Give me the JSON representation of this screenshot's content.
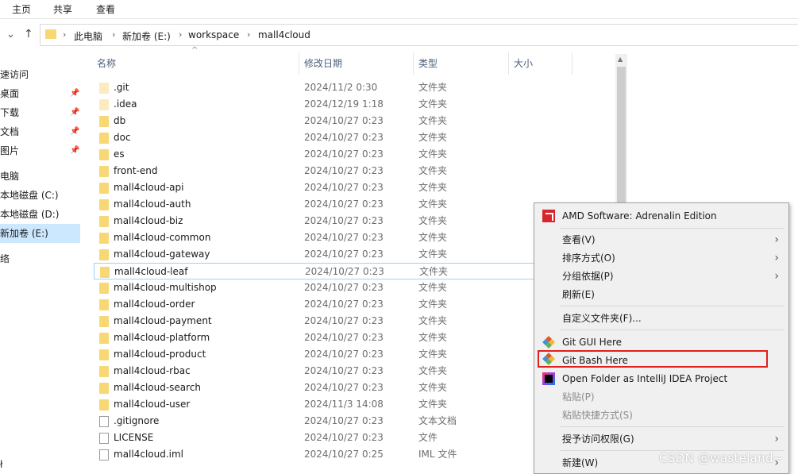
{
  "ribbon": {
    "tabs": [
      "主页",
      "共享",
      "查看"
    ]
  },
  "address": {
    "crumbs": [
      "此电脑",
      "新加卷 (E:)",
      "workspace",
      "mall4cloud"
    ],
    "separator": "›"
  },
  "nav": {
    "items": [
      {
        "label": "速访问",
        "pinned": false
      },
      {
        "label": "桌面",
        "pinned": true
      },
      {
        "label": "下载",
        "pinned": true
      },
      {
        "label": "文档",
        "pinned": true
      },
      {
        "label": "图片",
        "pinned": true
      },
      {
        "label": "电脑",
        "pinned": false
      },
      {
        "label": "本地磁盘 (C:)",
        "pinned": false
      },
      {
        "label": "本地磁盘 (D:)",
        "pinned": false
      },
      {
        "label": "新加卷 (E:)",
        "pinned": false,
        "selected": true
      },
      {
        "label": "络",
        "pinned": false
      }
    ],
    "bottom_item": "ł"
  },
  "columns": {
    "name": "名称",
    "date": "修改日期",
    "type": "类型",
    "size": "大小"
  },
  "files": [
    {
      "name": ".git",
      "date": "2024/11/2 0:30",
      "type": "文件夹",
      "kind": "folder-hidden"
    },
    {
      "name": ".idea",
      "date": "2024/12/19 1:18",
      "type": "文件夹",
      "kind": "folder-hidden"
    },
    {
      "name": "db",
      "date": "2024/10/27 0:23",
      "type": "文件夹",
      "kind": "folder"
    },
    {
      "name": "doc",
      "date": "2024/10/27 0:23",
      "type": "文件夹",
      "kind": "folder"
    },
    {
      "name": "es",
      "date": "2024/10/27 0:23",
      "type": "文件夹",
      "kind": "folder"
    },
    {
      "name": "front-end",
      "date": "2024/10/27 0:23",
      "type": "文件夹",
      "kind": "folder"
    },
    {
      "name": "mall4cloud-api",
      "date": "2024/10/27 0:23",
      "type": "文件夹",
      "kind": "folder"
    },
    {
      "name": "mall4cloud-auth",
      "date": "2024/10/27 0:23",
      "type": "文件夹",
      "kind": "folder"
    },
    {
      "name": "mall4cloud-biz",
      "date": "2024/10/27 0:23",
      "type": "文件夹",
      "kind": "folder"
    },
    {
      "name": "mall4cloud-common",
      "date": "2024/10/27 0:23",
      "type": "文件夹",
      "kind": "folder"
    },
    {
      "name": "mall4cloud-gateway",
      "date": "2024/10/27 0:23",
      "type": "文件夹",
      "kind": "folder"
    },
    {
      "name": "mall4cloud-leaf",
      "date": "2024/10/27 0:23",
      "type": "文件夹",
      "kind": "folder",
      "hover": true
    },
    {
      "name": "mall4cloud-multishop",
      "date": "2024/10/27 0:23",
      "type": "文件夹",
      "kind": "folder"
    },
    {
      "name": "mall4cloud-order",
      "date": "2024/10/27 0:23",
      "type": "文件夹",
      "kind": "folder"
    },
    {
      "name": "mall4cloud-payment",
      "date": "2024/10/27 0:23",
      "type": "文件夹",
      "kind": "folder"
    },
    {
      "name": "mall4cloud-platform",
      "date": "2024/10/27 0:23",
      "type": "文件夹",
      "kind": "folder"
    },
    {
      "name": "mall4cloud-product",
      "date": "2024/10/27 0:23",
      "type": "文件夹",
      "kind": "folder"
    },
    {
      "name": "mall4cloud-rbac",
      "date": "2024/10/27 0:23",
      "type": "文件夹",
      "kind": "folder"
    },
    {
      "name": "mall4cloud-search",
      "date": "2024/10/27 0:23",
      "type": "文件夹",
      "kind": "folder"
    },
    {
      "name": "mall4cloud-user",
      "date": "2024/11/3 14:08",
      "type": "文件夹",
      "kind": "folder"
    },
    {
      "name": ".gitignore",
      "date": "2024/10/27 0:23",
      "type": "文本文档",
      "kind": "file"
    },
    {
      "name": "LICENSE",
      "date": "2024/10/27 0:23",
      "type": "文件",
      "kind": "file"
    },
    {
      "name": "mall4cloud.iml",
      "date": "2024/10/27 0:25",
      "type": "IML 文件",
      "kind": "file"
    }
  ],
  "context_menu": {
    "items": [
      {
        "label": "AMD Software: Adrenalin Edition",
        "icon": "amd-icon",
        "submenu": false,
        "disabled": false
      },
      {
        "sep": true
      },
      {
        "label": "查看(V)",
        "submenu": true,
        "disabled": false
      },
      {
        "label": "排序方式(O)",
        "submenu": true,
        "disabled": false
      },
      {
        "label": "分组依据(P)",
        "submenu": true,
        "disabled": false
      },
      {
        "label": "刷新(E)",
        "submenu": false,
        "disabled": false
      },
      {
        "sep": true
      },
      {
        "label": "自定义文件夹(F)...",
        "submenu": false,
        "disabled": false
      },
      {
        "sep": true
      },
      {
        "label": "Git GUI Here",
        "icon": "git-icon",
        "submenu": false,
        "disabled": false
      },
      {
        "label": "Git Bash Here",
        "icon": "git-icon",
        "submenu": false,
        "disabled": false,
        "highlight": true
      },
      {
        "label": "Open Folder as IntelliJ IDEA Project",
        "icon": "intellij-icon",
        "submenu": false,
        "disabled": false
      },
      {
        "label": "粘贴(P)",
        "submenu": false,
        "disabled": true
      },
      {
        "label": "粘贴快捷方式(S)",
        "submenu": false,
        "disabled": true
      },
      {
        "sep": true
      },
      {
        "label": "授予访问权限(G)",
        "submenu": true,
        "disabled": false
      },
      {
        "sep": true
      },
      {
        "label": "新建(W)",
        "submenu": true,
        "disabled": false
      }
    ]
  },
  "watermark": "CSDN @wasteland~",
  "colors": {
    "selection": "#cce8ff",
    "hover_border": "#99d1ff",
    "highlight_box": "#e0201c",
    "folder": "#f8d775",
    "menu_bg": "#f0f0f0"
  }
}
